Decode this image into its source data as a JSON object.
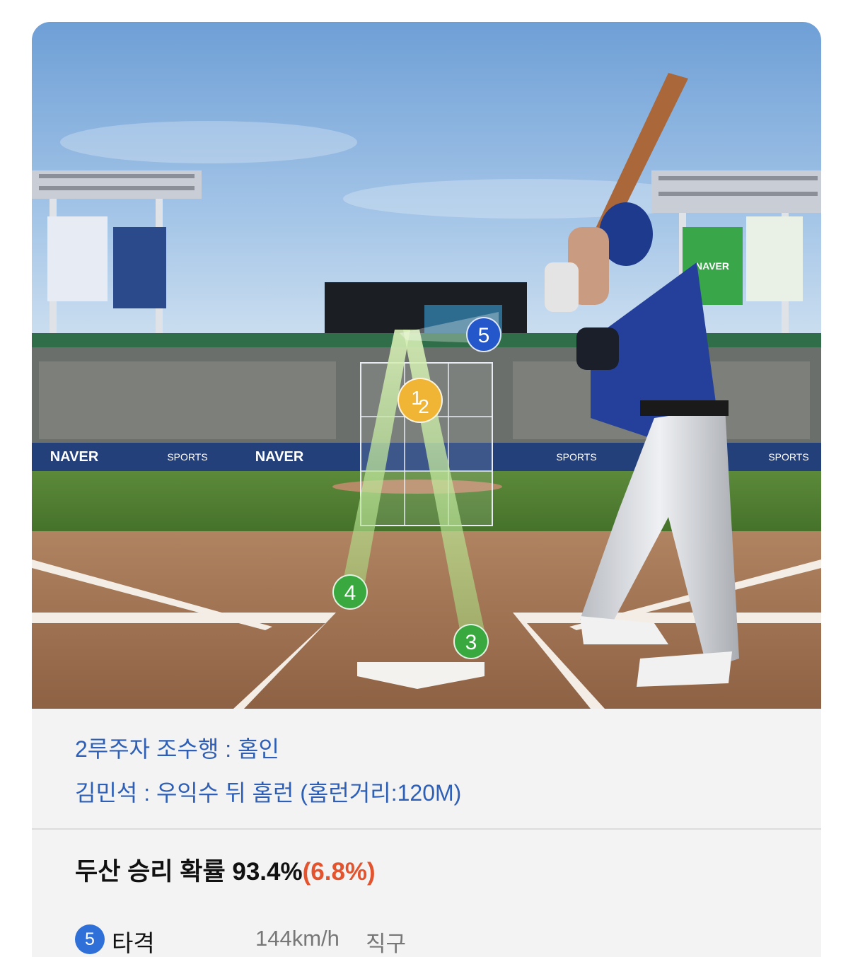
{
  "scene": {
    "banners": {
      "naver": "NAVER",
      "naver_sports": "SPORTS",
      "naver_small": "NAVER"
    },
    "pitch_markers": [
      {
        "label": "5",
        "color": "#2457c9"
      },
      {
        "label": "1",
        "color": "#f1b535"
      },
      {
        "label": "2",
        "color": "#f1b535"
      },
      {
        "label": "4",
        "color": "#39a83e"
      },
      {
        "label": "3",
        "color": "#39a83e"
      }
    ]
  },
  "events": [
    "2루주자 조수행 : 홈인",
    "김민석 : 우익수 뒤 홈런 (홈런거리:120M)"
  ],
  "win_probability": {
    "text": "두산 승리 확률 93.4%",
    "delta": "(6.8%)",
    "delta_color": "#e2532e"
  },
  "pitch": {
    "number": "5",
    "result": "타격",
    "speed": "144km/h",
    "type": "직구"
  },
  "colors": {
    "event_text": "#2e5fb7",
    "badge_blue": "#2e6fd8"
  }
}
